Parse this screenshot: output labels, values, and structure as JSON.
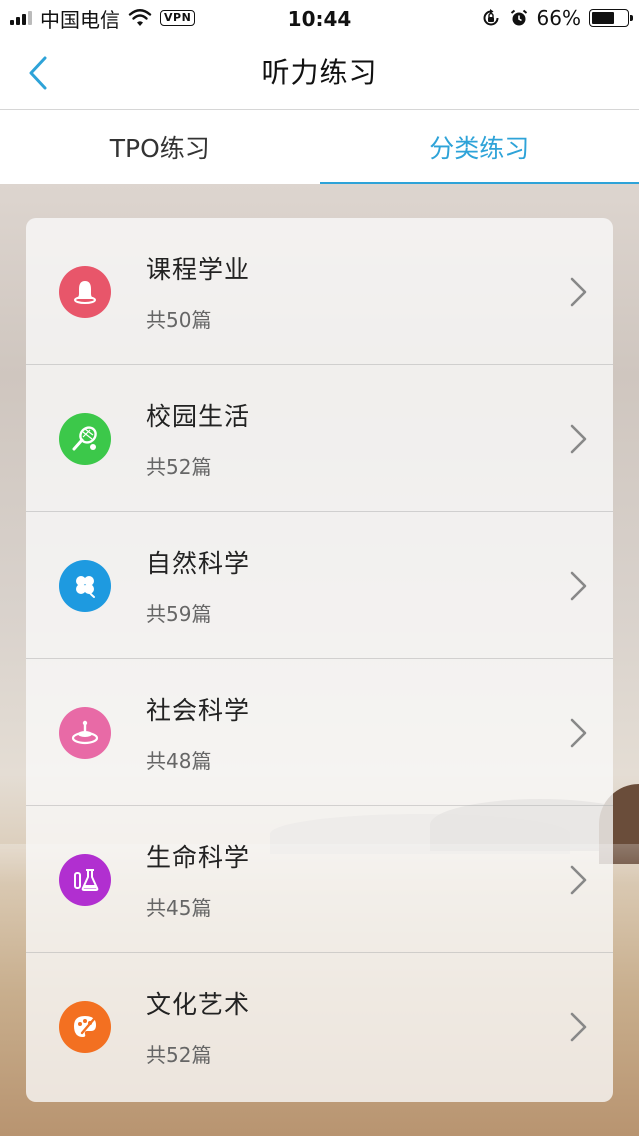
{
  "status_bar": {
    "carrier": "中国电信",
    "vpn": "VPN",
    "time": "10:44",
    "battery_text": "66%",
    "battery_level": 0.66
  },
  "nav": {
    "title": "听力练习",
    "back_icon": "chevron-left-icon"
  },
  "tabs": [
    {
      "label": "TPO练习",
      "active": false
    },
    {
      "label": "分类练习",
      "active": true
    }
  ],
  "colors": {
    "accent": "#2ea3d8"
  },
  "categories": [
    {
      "title": "课程学业",
      "count": "共50篇",
      "icon": "bell-icon",
      "color": "#e8566a"
    },
    {
      "title": "校园生活",
      "count": "共52篇",
      "icon": "tennis-racket-icon",
      "color": "#3cc84a"
    },
    {
      "title": "自然科学",
      "count": "共59篇",
      "icon": "clover-icon",
      "color": "#1e9ae0"
    },
    {
      "title": "社会科学",
      "count": "共48篇",
      "icon": "globe-stand-icon",
      "color": "#e86aa6"
    },
    {
      "title": "生命科学",
      "count": "共45篇",
      "icon": "flask-icon",
      "color": "#b12fd0"
    },
    {
      "title": "文化艺术",
      "count": "共52篇",
      "icon": "palette-icon",
      "color": "#f37021"
    }
  ]
}
